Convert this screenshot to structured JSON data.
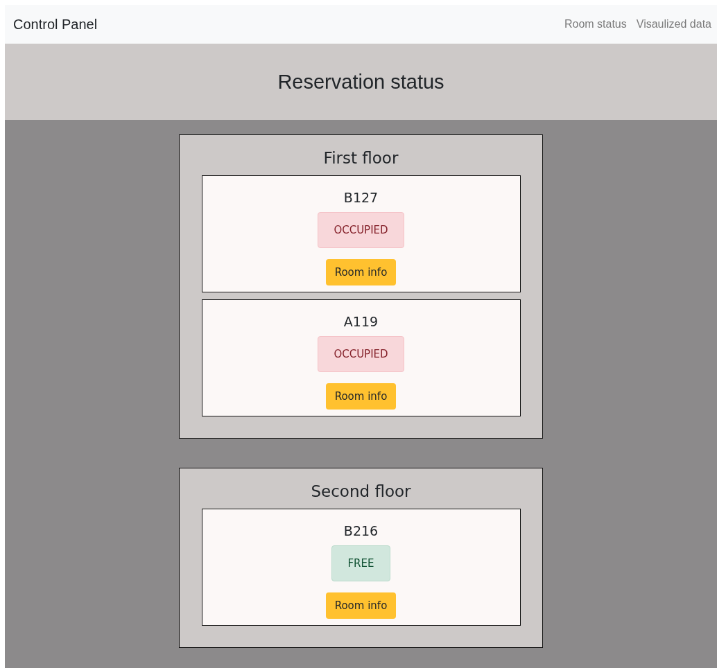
{
  "navbar": {
    "brand": "Control Panel",
    "links": [
      {
        "label": "Room status"
      },
      {
        "label": "Visaulized data"
      }
    ]
  },
  "header": {
    "title": "Reservation status"
  },
  "floors": [
    {
      "title": "First floor",
      "rooms": [
        {
          "name": "B127",
          "status": {
            "label": "OCCUPIED",
            "kind": "occupied"
          },
          "button": "Room info"
        },
        {
          "name": "A119",
          "status": {
            "label": "OCCUPIED",
            "kind": "occupied"
          },
          "button": "Room info"
        }
      ]
    },
    {
      "title": "Second floor",
      "rooms": [
        {
          "name": "B216",
          "status": {
            "label": "FREE",
            "kind": "free"
          },
          "button": "Room info"
        }
      ]
    }
  ]
}
